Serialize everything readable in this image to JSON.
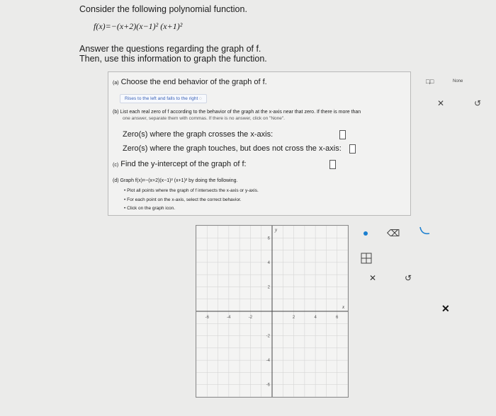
{
  "intro": {
    "line1": "Consider the following polynomial function.",
    "function": "f(x)=−(x+2)(x−1)² (x+1)²",
    "line2": "Answer the questions regarding the graph of f.",
    "line3": "Then, use this information to graph the function."
  },
  "question_a": {
    "prompt": "Choose the end behavior of the graph of f.",
    "prefix": "(a)",
    "selected_answer": "Rises to the left and falls to the right"
  },
  "question_b": {
    "prefix": "(b)",
    "prompt": "List each real zero of f according to the behavior of the graph at the x-axis near that zero. If there is more than",
    "prompt_cont": "one answer, separate them with commas. If there is no answer, click on \"None\".",
    "crosses_label": "Zero(s) where the graph crosses the x-axis:",
    "touches_label": "Zero(s) where the graph touches, but does not cross the x-axis:"
  },
  "question_c": {
    "prefix": "(c)",
    "prompt": "Find the y-intercept of the graph of f:"
  },
  "question_d": {
    "prefix": "(d)",
    "prompt": "Graph f(x)=−(x+2)(x−1)² (x+1)² by doing the following.",
    "bullets": [
      "Plot all points where the graph of f intersects the x-axis or y-axis.",
      "For each point on the x-axis, select the correct behavior.",
      "Click on the graph icon."
    ]
  },
  "top_tools": {
    "none_label": "None",
    "clear_icon": "x-icon",
    "undo_icon": "undo-icon"
  },
  "graph": {
    "x_ticks": [
      "-6",
      "-4",
      "-2",
      "2",
      "4",
      "6"
    ],
    "y_ticks": [
      "6",
      "4",
      "2",
      "-2",
      "-4",
      "-6"
    ],
    "x_axis_label": "x",
    "y_axis_label": "y",
    "xlim": [
      -7,
      7
    ],
    "ylim": [
      -7,
      7
    ]
  },
  "graph_tools": {
    "point_icon": "point-icon",
    "eraser_icon": "eraser-icon",
    "curve_icon": "curve-icon",
    "grid_icon": "grid-icon",
    "clear_icon": "x-icon",
    "undo_icon": "undo-icon"
  },
  "colors": {
    "point_blue": "#1a7fd0",
    "link_blue": "#3a62b8"
  }
}
